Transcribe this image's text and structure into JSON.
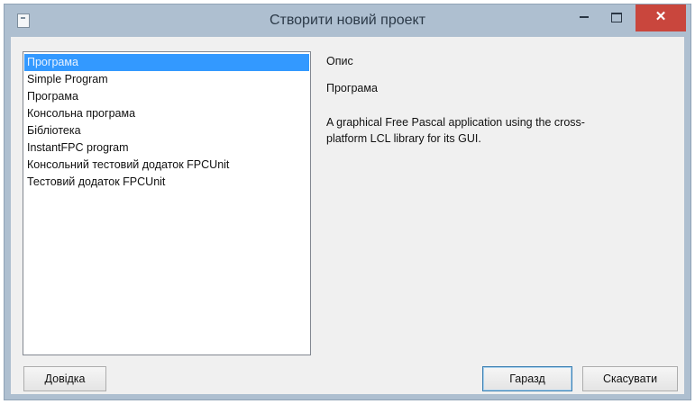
{
  "window": {
    "title": "Створити новий проект"
  },
  "list": {
    "items": [
      {
        "label": "Програма",
        "selected": true
      },
      {
        "label": "Simple Program",
        "selected": false
      },
      {
        "label": "Програма",
        "selected": false
      },
      {
        "label": "Консольна програма",
        "selected": false
      },
      {
        "label": "Бібліотека",
        "selected": false
      },
      {
        "label": "InstantFPC program",
        "selected": false
      },
      {
        "label": "Консольний тестовий додаток FPCUnit",
        "selected": false
      },
      {
        "label": "Тестовий додаток FPCUnit",
        "selected": false
      }
    ]
  },
  "description": {
    "header": "Опис",
    "name": "Програма",
    "text": "A graphical Free Pascal application using the cross-platform LCL library for its GUI."
  },
  "buttons": {
    "help": "Довідка",
    "ok": "Гаразд",
    "cancel": "Скасувати",
    "close_glyph": "✕"
  },
  "colors": {
    "frame": "#aebfd0",
    "close": "#c9463d",
    "selection": "#3399ff"
  }
}
